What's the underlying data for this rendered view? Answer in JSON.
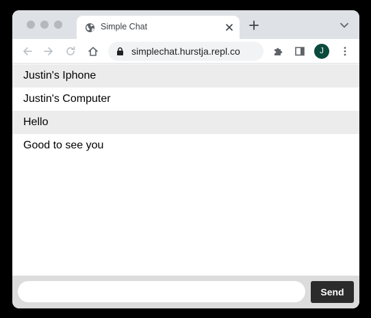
{
  "browser": {
    "tab": {
      "title": "Simple Chat",
      "favicon": "globe-icon"
    },
    "address_bar": {
      "url": "simplechat.hurstja.repl.co"
    },
    "profile_initial": "J",
    "profile_color": "#0b4a3d"
  },
  "chat": {
    "messages": [
      {
        "text": "Justin's Iphone"
      },
      {
        "text": "Justin's Computer"
      },
      {
        "text": "Hello"
      },
      {
        "text": "Good to see you"
      }
    ]
  },
  "composer": {
    "input_value": "",
    "send_label": "Send"
  }
}
